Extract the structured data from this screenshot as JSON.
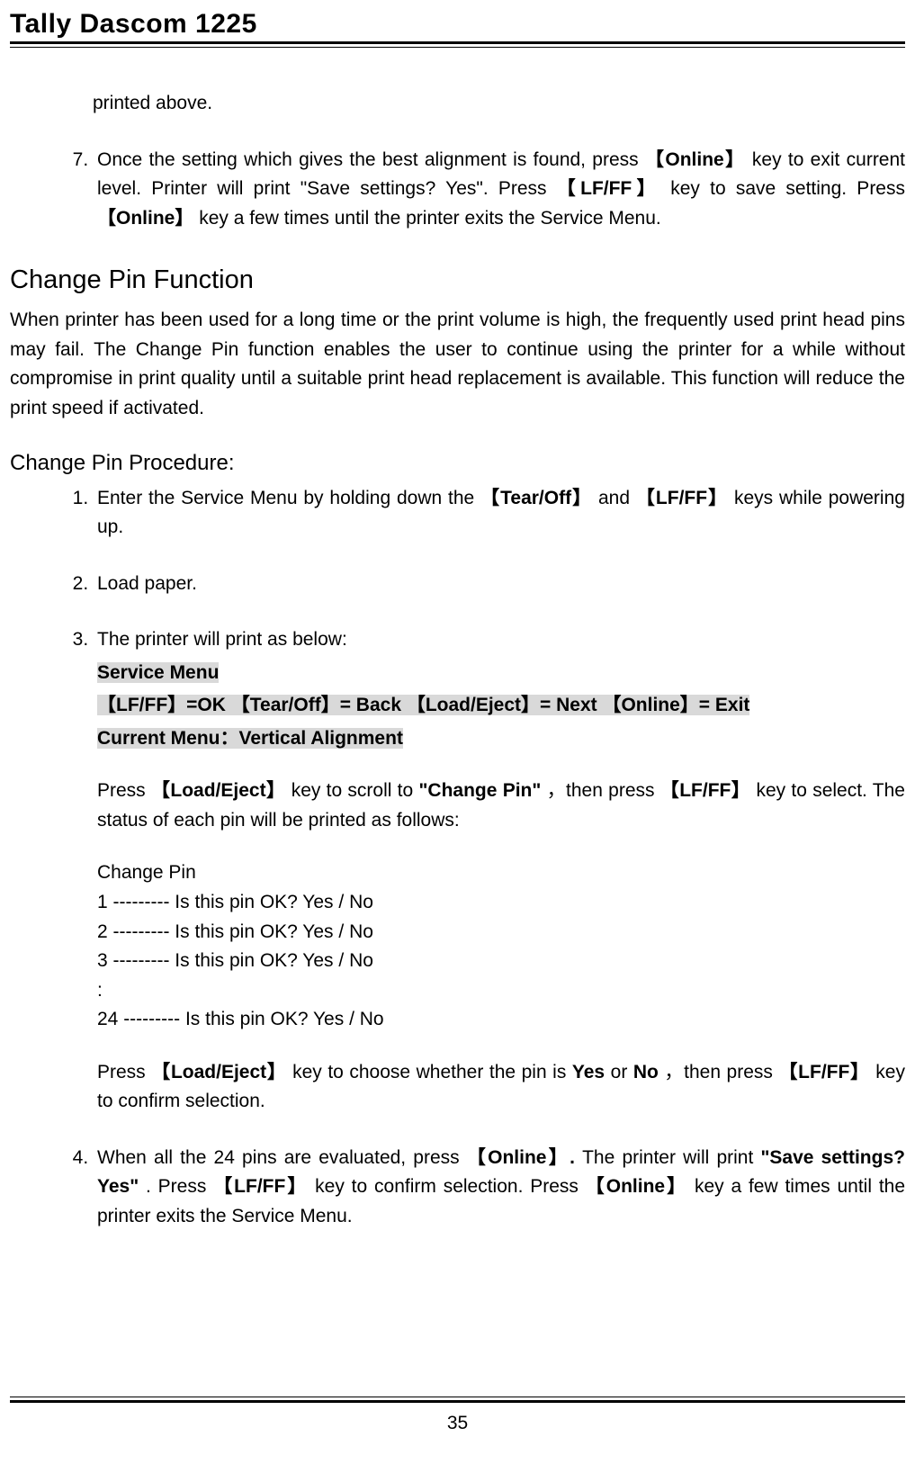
{
  "header": {
    "title": "Tally Dascom 1225"
  },
  "top": {
    "continued": "printed above.",
    "item7_a": "Once the setting which gives the best alignment is found, press ",
    "item7_online1": "【Online】",
    "item7_b": " key to exit current level. Printer will print \"Save settings? Yes\". Press ",
    "item7_lfff": "【LF/FF】",
    "item7_c": " key to save setting. Press ",
    "item7_online2": "【Online】",
    "item7_d": " key a few times until the printer exits the Service Menu."
  },
  "section": {
    "title": "Change Pin Function",
    "intro": "When printer has been used for a long time or the print volume is high, the frequently used print head pins may fail. The Change Pin function enables the user to continue using the printer for a while without compromise in print quality until a suitable print head replacement is available. This function will reduce the print speed if activated.",
    "procedure_title": "Change Pin Procedure:"
  },
  "steps": {
    "s1_a": "Enter the Service Menu by holding down the",
    "s1_tear": "【Tear/Off】",
    "s1_and": "and",
    "s1_lfff": "【LF/FF】",
    "s1_b": "keys while powering up.",
    "s2": "Load paper.",
    "s3_lead": "The printer will print as below:",
    "s3_menu": "Service Menu",
    "s3_keys": "【LF/FF】=OK   【Tear/Off】= Back   【Load/Eject】= Next   【Online】= Exit",
    "s3_current": "Current Menu：Vertical Alignment",
    "s3_p1_a": "Press ",
    "s3_p1_load": "【Load/Eject】",
    "s3_p1_b": " key to scroll to ",
    "s3_p1_change": "\"Change Pin\"",
    "s3_p1_c": "，then press ",
    "s3_p1_lfff": "【LF/FF】",
    "s3_p1_d": " key to select. The status of each pin will be printed as follows:",
    "s3_cp_title": "Change Pin",
    "s3_pin1": "1 --------- Is this pin OK? Yes / No",
    "s3_pin2": "2 --------- Is this pin OK? Yes / No",
    "s3_pin3": "3 --------- Is this pin OK? Yes / No",
    "s3_pindots": ":",
    "s3_pin24": "24 --------- Is this pin OK? Yes / No",
    "s3_p2_a": "Press",
    "s3_p2_load": "【Load/Eject】",
    "s3_p2_b": "key to choose whether the pin is ",
    "s3_p2_yes": "Yes",
    "s3_p2_or": " or ",
    "s3_p2_no": "No",
    "s3_p2_c": "，then press",
    "s3_p2_lfff": "【LF/FF】",
    "s3_p2_d": "key to confirm selection.",
    "s4_a": "When all the 24 pins are evaluated, press",
    "s4_online": "【Online】.",
    "s4_b": " The printer will print ",
    "s4_save": "\"Save settings? Yes\"",
    "s4_c": ". Press ",
    "s4_lfff": "【LF/FF】",
    "s4_d": "key to confirm selection. Press",
    "s4_online2": "【Online】",
    "s4_e": "key a few times until the printer exits the Service Menu."
  },
  "footer": {
    "page": "35"
  }
}
